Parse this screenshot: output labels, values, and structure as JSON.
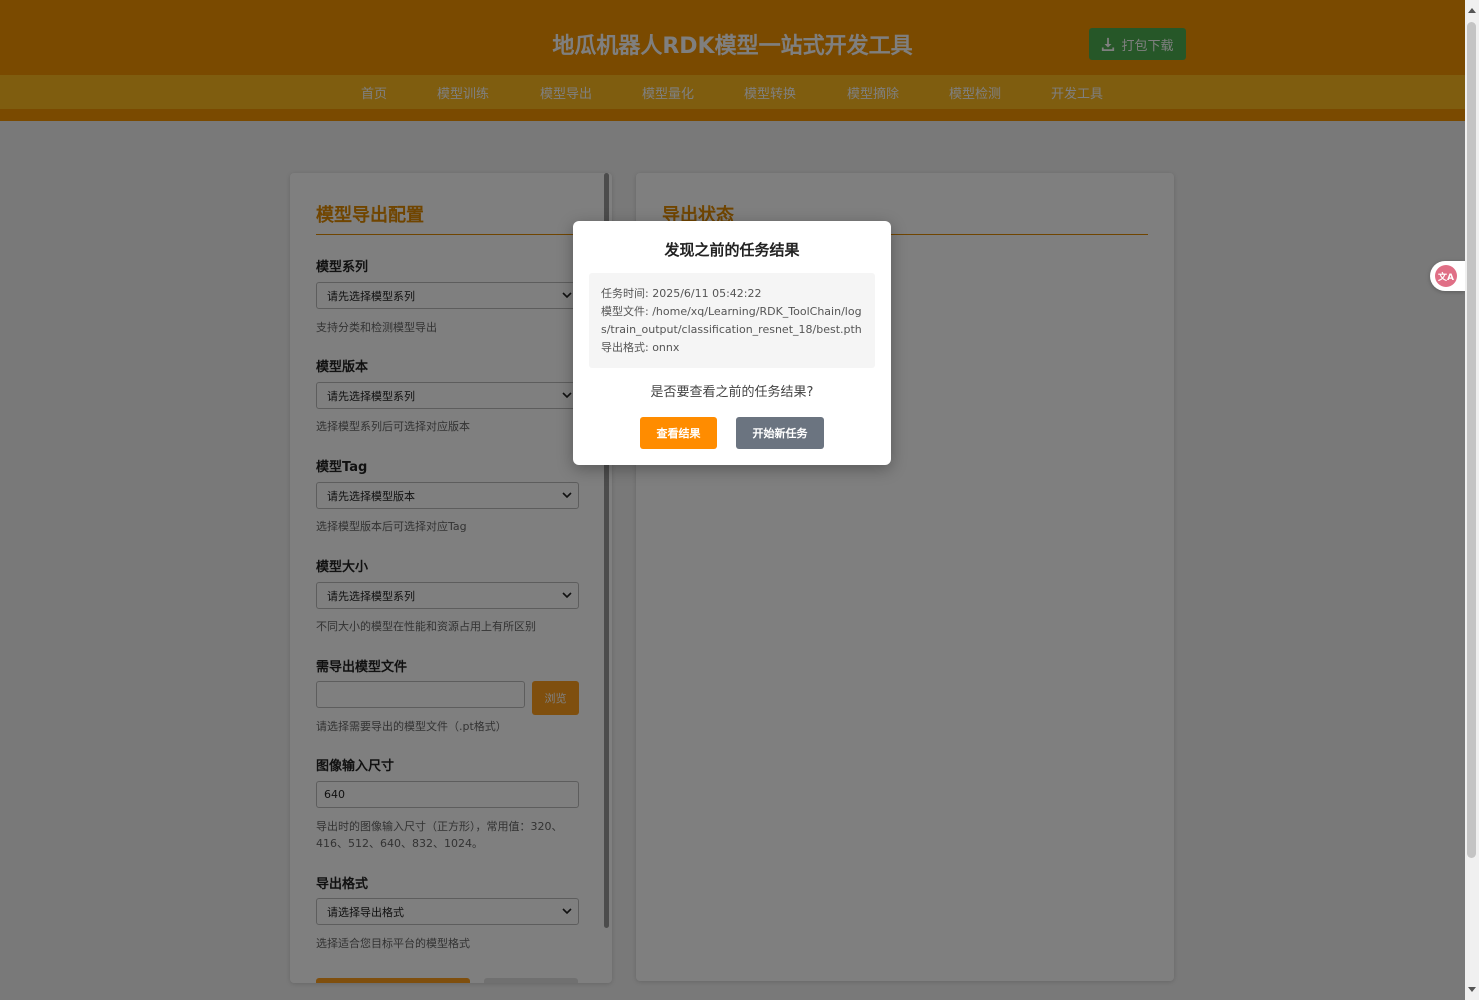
{
  "header": {
    "title": "地瓜机器人RDK模型一站式开发工具",
    "download_label": "打包下载"
  },
  "nav": {
    "items": [
      {
        "label": "首页"
      },
      {
        "label": "模型训练"
      },
      {
        "label": "模型导出"
      },
      {
        "label": "模型量化"
      },
      {
        "label": "模型转换"
      },
      {
        "label": "模型摘除"
      },
      {
        "label": "模型检测"
      },
      {
        "label": "开发工具"
      }
    ]
  },
  "config": {
    "title": "模型导出配置",
    "fields": {
      "series": {
        "label": "模型系列",
        "value": "请先选择模型系列",
        "hint": "支持分类和检测模型导出"
      },
      "version": {
        "label": "模型版本",
        "value": "请先选择模型系列",
        "hint": "选择模型系列后可选择对应版本"
      },
      "tag": {
        "label": "模型Tag",
        "value": "请先选择模型版本",
        "hint": "选择模型版本后可选择对应Tag"
      },
      "size": {
        "label": "模型大小",
        "value": "请先选择模型系列",
        "hint": "不同大小的模型在性能和资源占用上有所区别"
      },
      "file": {
        "label": "需导出模型文件",
        "value": "",
        "browse_label": "浏览",
        "hint": "请选择需要导出的模型文件（.pt格式）"
      },
      "imgsz": {
        "label": "图像输入尺寸",
        "value": "640",
        "hint": "导出时的图像输入尺寸（正方形），常用值：320、416、512、640、832、1024。"
      },
      "format": {
        "label": "导出格式",
        "value": "请选择导出格式",
        "hint": "选择适合您目标平台的模型格式"
      }
    }
  },
  "status": {
    "title": "导出状态"
  },
  "modal": {
    "title": "发现之前的任务结果",
    "task_time": "任务时间: 2025/6/11 05:42:22",
    "model_file": "模型文件: /home/xq/Learning/RDK_ToolChain/logs/train_output/classification_resnet_18/best.pth",
    "export_format": "导出格式: onnx",
    "question": "是否要查看之前的任务结果?",
    "view_label": "查看结果",
    "new_label": "开始新任务"
  },
  "translate": {
    "label": "文A"
  },
  "colors": {
    "primary": "#f59400",
    "nav": "#ffbb1f",
    "accent_text": "#e08a00",
    "download": "#4caf50",
    "secondary_btn": "#6b7480"
  }
}
